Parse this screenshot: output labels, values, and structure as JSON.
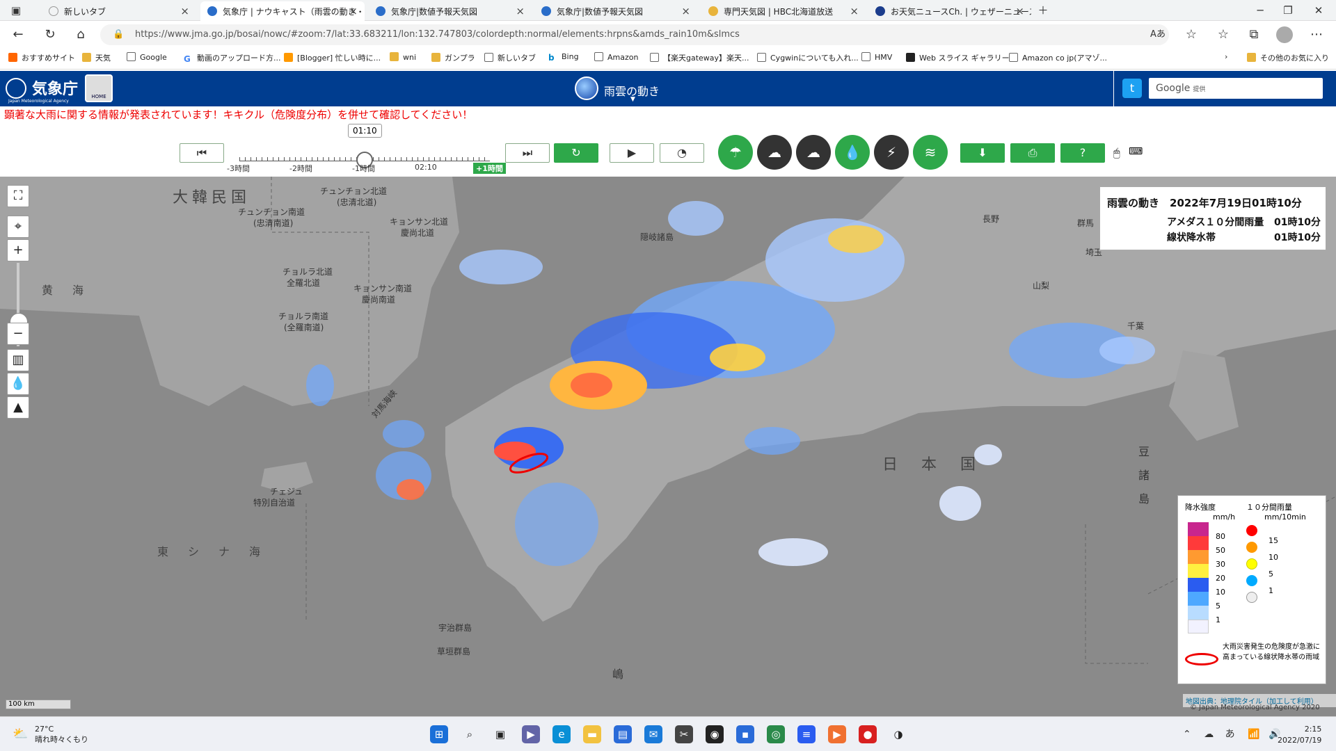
{
  "browser": {
    "tabs": [
      {
        "label": "新しいタブ"
      },
      {
        "label": "気象庁 | ナウキャスト（雨雲の動き・"
      },
      {
        "label": "気象庁|数値予報天気図"
      },
      {
        "label": "気象庁|数値予報天気図"
      },
      {
        "label": "専門天気図 | HBC北海道放送"
      },
      {
        "label": "お天気ニュースCh. | ウェザーニュース"
      }
    ],
    "url": "https://www.jma.go.jp/bosai/nowc/#zoom:7/lat:33.683211/lon:132.747803/colordepth:normal/elements:hrpns&amds_rain10m&slmcs",
    "bookmarks": [
      "おすすめサイト",
      "天気",
      "Google",
      "動画のアップロード方...",
      "[Blogger] 忙しい時に...",
      "wni",
      "ガンプラ",
      "新しいタブ",
      "Bing",
      "Amazon",
      "【楽天gateway】楽天...",
      "Cygwinについても入れ...",
      "HMV",
      "Web スライス ギャラリー",
      "Amazon co jp(アマゾ...",
      "その他のお気に入り"
    ]
  },
  "jma": {
    "logo": "気象庁",
    "logo_sub": "Japan Meteorological Agency",
    "home": "HOME",
    "page_title": "雨雲の動き",
    "search_placeholder": "Google",
    "search_suffix": "提供",
    "warning": "顕著な大雨に関する情報が発表されています！キキクル（危険度分布）を併せて確認してください！"
  },
  "timeline": {
    "current": "01:10",
    "ticks": [
      "-3時間",
      "-2時間",
      "-1時間",
      "02:10",
      "+1時間"
    ]
  },
  "info": {
    "title": "雨雲の動き　2022年7月19日01時10分",
    "row1_label": "アメダス１０分間雨量",
    "row1_time": "01時10分",
    "row2_label": "線状降水帯",
    "row2_time": "01時10分"
  },
  "map_labels": {
    "korea": "大韓民国",
    "japan": "日　本　国",
    "yellow_sea": "黄　海",
    "east_china_sea": "東　シ　ナ　海",
    "chungnam": "チュンチョン南道",
    "chungnam2": "(忠清南道)",
    "chungbuk": "チュンチョン北道",
    "chungbuk2": "(忠清北道)",
    "gyeongbuk": "キョンサン北道",
    "gyeongbuk2": "慶尚北道",
    "jeonbuk": "チョルラ北道",
    "jeonbuk2": "全羅北道",
    "gyeongnam": "キョンサン南道",
    "gyeongnam2": "慶尚南道",
    "jeonnam": "チョルラ南道",
    "jeonnam2": "(全羅南道)",
    "jeju": "チェジュ",
    "jeju2": "特別自治道",
    "oki": "隠岐諸島",
    "tsushima": "対馬海峡",
    "uji": "宇治群島",
    "kusagaki": "草垣群島",
    "izu": "豆",
    "izu2": "諸",
    "izu3": "島",
    "kai": "嶋",
    "gunma": "群馬",
    "saitama": "埼玉",
    "yamanashi": "山梨",
    "chiba": "千葉",
    "nagano": "長野"
  },
  "legend": {
    "title1": "降水強度",
    "unit1": "mm/h",
    "title2": "１０分間雨量",
    "unit2": "mm/10min",
    "levels": [
      "80",
      "50",
      "30",
      "20",
      "10",
      "5",
      "1"
    ],
    "levels10": [
      "15",
      "10",
      "5",
      "1"
    ],
    "note": "大雨災害発生の危険度が急激に高まっている線状降水帯の雨域"
  },
  "map_credit": "地図出典：地理院タイル（加工して利用）",
  "copyright": "© Japan Meteorological Agency 2020",
  "scale": "100 km",
  "colors": {
    "jma_blue": "#003d8f",
    "green": "#2ea84a",
    "warning_red": "#e00"
  },
  "taskbar": {
    "temp": "27°C",
    "weather": "晴れ時々くもり",
    "time": "2:15",
    "date": "2022/07/19",
    "ime": "あ"
  }
}
